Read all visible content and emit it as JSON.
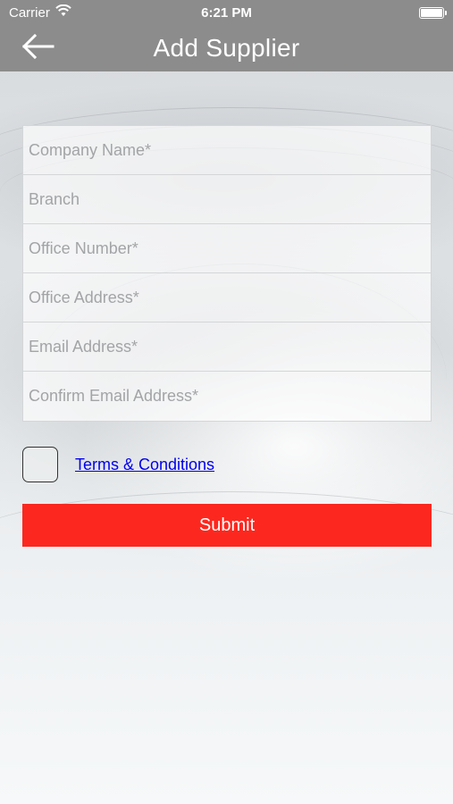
{
  "status_bar": {
    "carrier": "Carrier",
    "time": "6:21 PM",
    "wifi_icon": "wifi-icon",
    "battery_icon": "battery-icon"
  },
  "nav": {
    "title": "Add Supplier",
    "back_icon": "arrow-left-icon"
  },
  "form": {
    "fields": [
      {
        "name": "company-name-input",
        "placeholder": "Company Name*"
      },
      {
        "name": "branch-input",
        "placeholder": "Branch"
      },
      {
        "name": "office-number-input",
        "placeholder": "Office Number*"
      },
      {
        "name": "office-address-input",
        "placeholder": "Office Address*"
      },
      {
        "name": "email-address-input",
        "placeholder": "Email Address*"
      },
      {
        "name": "confirm-email-address-input",
        "placeholder": "Confirm Email Address*"
      }
    ],
    "terms_label": "Terms & Conditions",
    "terms_checked": false,
    "submit_label": "Submit"
  },
  "colors": {
    "header_bg": "#8c8c8c",
    "submit_bg": "#fc281f",
    "link": "#0000ee"
  }
}
